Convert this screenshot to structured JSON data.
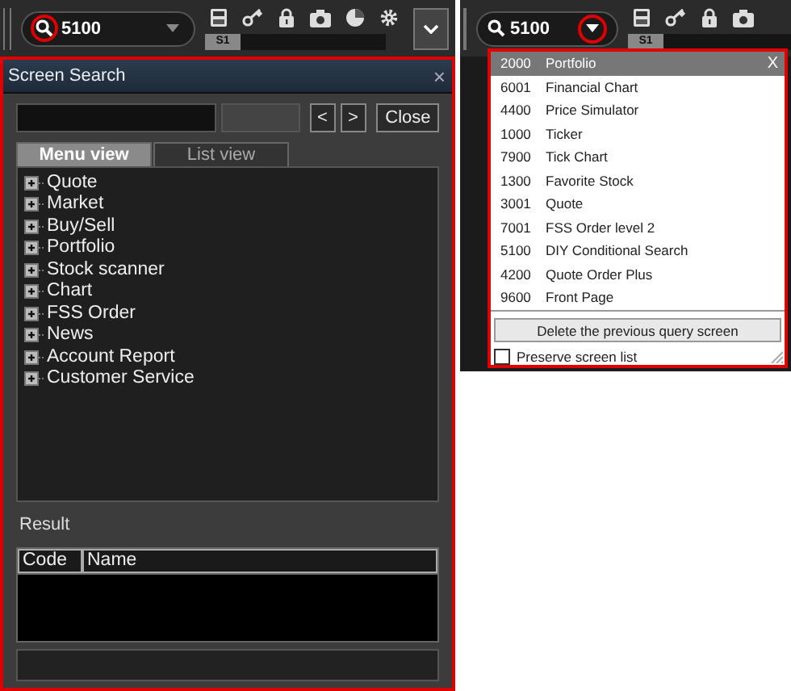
{
  "left_toolbar": {
    "search": {
      "value": "5100"
    },
    "slot_label": "S1"
  },
  "screen_search": {
    "title": "Screen Search",
    "close": "×",
    "nav": [
      "<",
      ">"
    ],
    "close_button": "Close",
    "tabs": [
      {
        "label": "Menu view",
        "selected": true
      },
      {
        "label": "List view",
        "selected": false
      }
    ],
    "tree": [
      {
        "label": "Quote",
        "expanded": false
      },
      {
        "label": "Market",
        "expanded": false
      },
      {
        "label": "Buy/Sell",
        "expanded": false
      },
      {
        "label": "Portfolio",
        "expanded": false
      },
      {
        "label": "Stock scanner",
        "expanded": false
      },
      {
        "label": "Chart",
        "expanded": false
      },
      {
        "label": "FSS Order",
        "expanded": false
      },
      {
        "label": "News",
        "expanded": false
      },
      {
        "label": "Account Report",
        "expanded": false
      },
      {
        "label": "Customer Service",
        "expanded": false
      }
    ],
    "result_label": "Result",
    "columns": [
      "Code",
      "Name"
    ]
  },
  "right_toolbar": {
    "search": {
      "value": "5100"
    },
    "slot_label": "S1"
  },
  "recent_screens": {
    "close": "X",
    "items": [
      {
        "code": "2000",
        "name": "Portfolio",
        "selected": true
      },
      {
        "code": "6001",
        "name": "Financial Chart",
        "selected": false
      },
      {
        "code": "4400",
        "name": "Price Simulator",
        "selected": false
      },
      {
        "code": "1000",
        "name": "Ticker",
        "selected": false
      },
      {
        "code": "7900",
        "name": "Tick Chart",
        "selected": false
      },
      {
        "code": "1300",
        "name": "Favorite Stock",
        "selected": false
      },
      {
        "code": "3001",
        "name": "Quote",
        "selected": false
      },
      {
        "code": "7001",
        "name": "FSS Order level 2",
        "selected": false
      },
      {
        "code": "5100",
        "name": "DIY Conditional Search",
        "selected": false
      },
      {
        "code": "4200",
        "name": "Quote Order Plus",
        "selected": false
      },
      {
        "code": "9600",
        "name": "Front Page",
        "selected": false
      }
    ],
    "delete_button": "Delete the previous query screen",
    "preserve": {
      "label": "Preserve screen list",
      "checked": false
    }
  }
}
